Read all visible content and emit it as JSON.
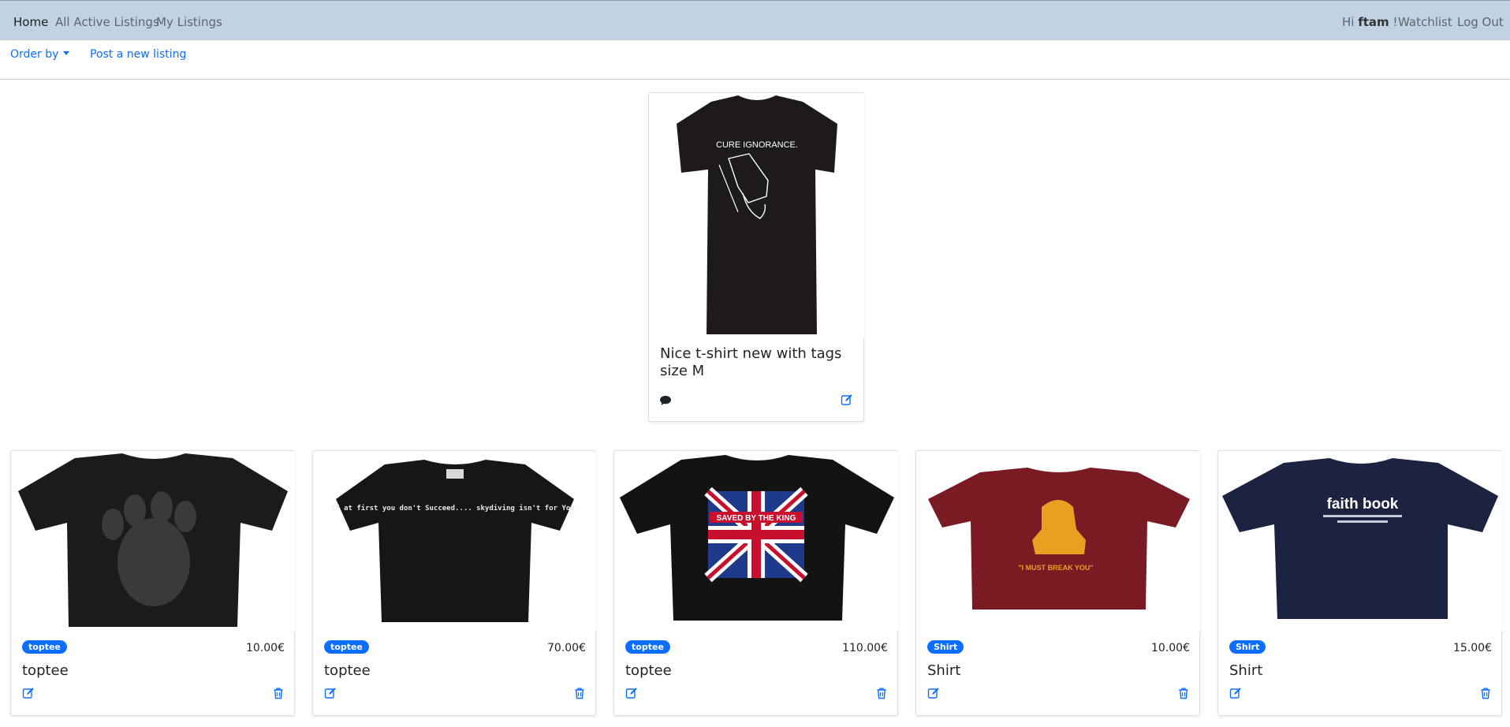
{
  "navbar": {
    "links": [
      {
        "label": "Home",
        "active": true
      },
      {
        "label": "All Active Listings",
        "active": false
      },
      {
        "label": "My Listings",
        "active": false
      }
    ],
    "greeting_prefix": "Hi",
    "username": "ftam",
    "greeting_suffix": "!",
    "watchlist_label": "Watchlist",
    "logout_label": "Log Out"
  },
  "subnav": {
    "order_by_label": "Order by",
    "post_label": "Post a new listing"
  },
  "featured": {
    "title": "Nice t-shirt new with tags size M",
    "shirt_text": "CURE IGNORANCE.",
    "shirt_color": "#1e1a1a",
    "icons": [
      "comment-icon",
      "edit-icon"
    ]
  },
  "listings": [
    {
      "category": "toptee",
      "price": "10.00€",
      "title": "toptee",
      "shirt_color": "#1b1b1b",
      "shirt_text": ""
    },
    {
      "category": "toptee",
      "price": "70.00€",
      "title": "toptee",
      "shirt_color": "#161616",
      "shirt_text": "if at first you don't Succeed.... skydiving isn't for You."
    },
    {
      "category": "toptee",
      "price": "110.00€",
      "title": "toptee",
      "shirt_color": "#131313",
      "shirt_text": "SAVED BY THE KING"
    },
    {
      "category": "Shirt",
      "price": "10.00€",
      "title": "Shirt",
      "shirt_color": "#7a1a22",
      "shirt_text": "\"I MUST BREAK YOU\""
    },
    {
      "category": "Shirt",
      "price": "15.00€",
      "title": "Shirt",
      "shirt_color": "#1b2340",
      "shirt_text": "faith book"
    }
  ],
  "colors": {
    "navbar_bg": "#c1d3e2",
    "link_blue": "#0d6efd",
    "badge_blue": "#0d6efd"
  }
}
